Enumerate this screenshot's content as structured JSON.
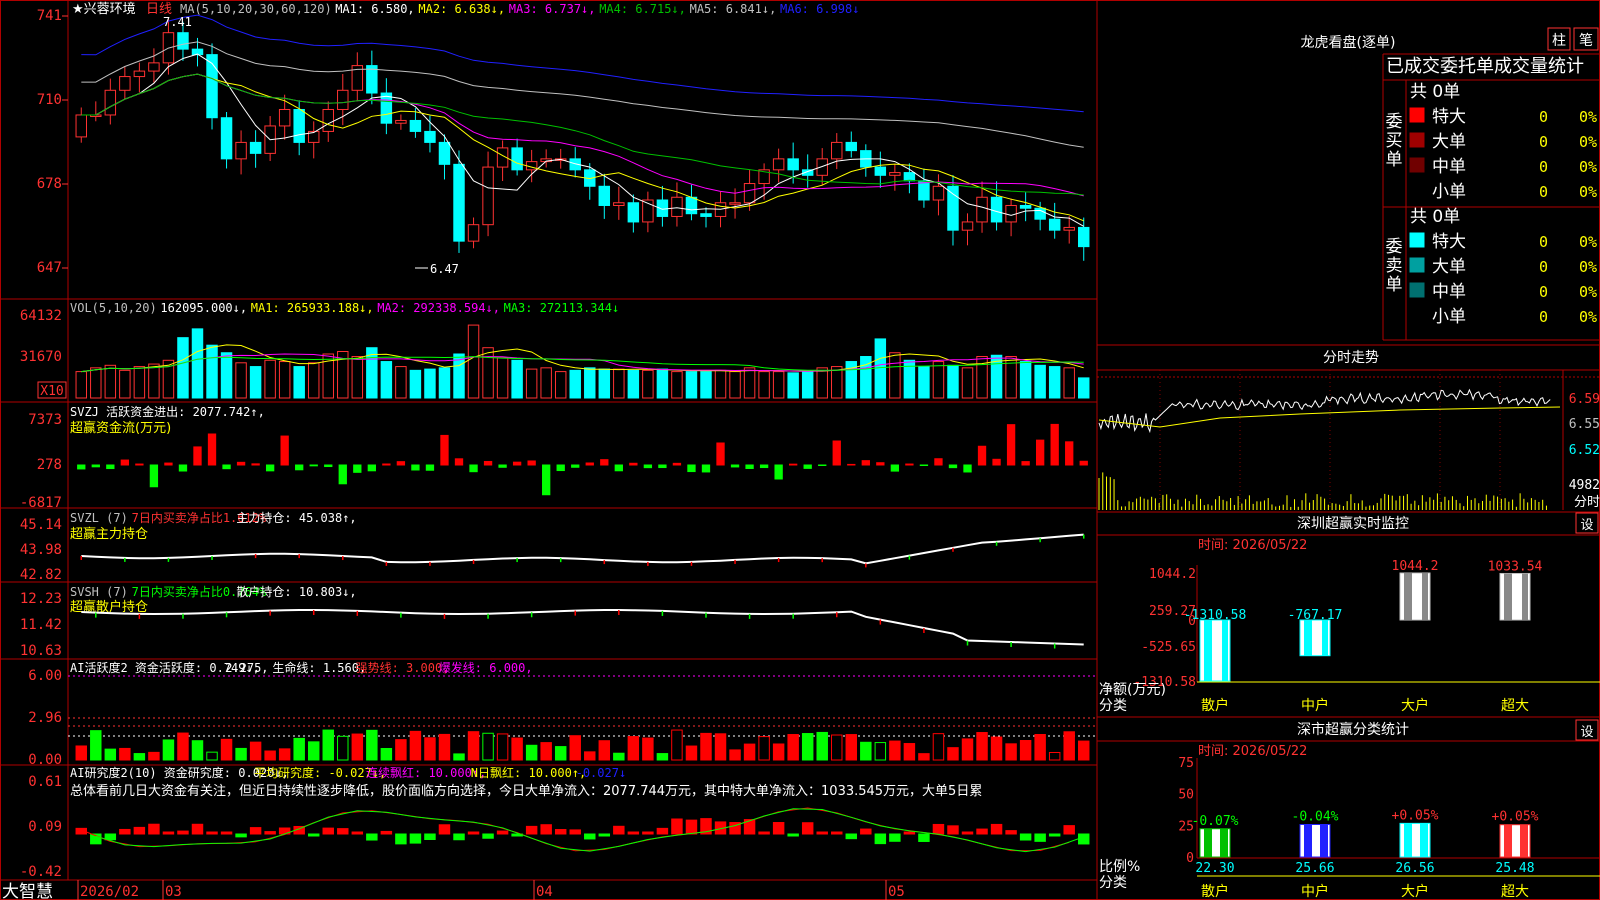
{
  "app": {
    "brand": "大智慧",
    "stock_name": "★兴蓉环境",
    "period": "日线",
    "pan_high_label": "7.41",
    "pan_low_label": "6.47"
  },
  "colors": {
    "up": "#ff3232",
    "down": "#00ffff",
    "grid": "#b00000",
    "ma1": "#ffffff",
    "ma2": "#ffff00",
    "ma3": "#ff00ff",
    "ma4": "#00c000",
    "ma5": "#c0c0c0",
    "ma6": "#2020ff"
  },
  "price_panel": {
    "header": [
      {
        "t": "MA(5,10,20,30,60,120)",
        "c": "#c0c0c0"
      },
      {
        "t": "MA1: 6.580,",
        "c": "#ffffff"
      },
      {
        "t": "MA2: 6.638↓,",
        "c": "#ffff00"
      },
      {
        "t": "MA3: 6.737↓,",
        "c": "#ff00ff"
      },
      {
        "t": "MA4: 6.715↓,",
        "c": "#00c000"
      },
      {
        "t": "MA5: 6.841↓,",
        "c": "#c0c0c0"
      },
      {
        "t": "MA6: 6.998↓",
        "c": "#2020ff"
      }
    ],
    "yticks": [
      "741",
      "710",
      "678",
      "647"
    ]
  },
  "vol_panel": {
    "header": [
      {
        "t": "VOL(5,10,20)",
        "c": "#c0c0c0"
      },
      {
        "t": "162095.000↓,",
        "c": "#ffffff"
      },
      {
        "t": "MA1: 265933.188↓,",
        "c": "#ffff00"
      },
      {
        "t": "MA2: 292338.594↓,",
        "c": "#ff00ff"
      },
      {
        "t": "MA3: 272113.344↓",
        "c": "#00ff00"
      }
    ],
    "yticks": [
      "64132",
      "31670"
    ],
    "unit": "X10"
  },
  "svzj_panel": {
    "header": [
      {
        "t": "SVZJ  活跃资金进出: 2077.742↑,",
        "c": "#ffffff"
      }
    ],
    "sub": "超赢资金流(万元)",
    "yticks": [
      "7373",
      "278",
      "-6817"
    ]
  },
  "svzl_panel": {
    "header": [
      {
        "t": "SVZL (7)",
        "c": "#c0c0c0"
      },
      {
        "t": "7日内买卖净占比1.612%",
        "c": "#ff3232"
      },
      {
        "t": "主力持仓: 45.038↑,",
        "c": "#ffffff"
      }
    ],
    "sub": "超赢主力持仓",
    "yticks": [
      "45.14",
      "43.98",
      "42.82"
    ]
  },
  "svsh_panel": {
    "header": [
      {
        "t": "SVSH (7)",
        "c": "#c0c0c0"
      },
      {
        "t": "7日内买卖净占比0.764%",
        "c": "#00ff00"
      },
      {
        "t": "散户持仓: 10.803↓,",
        "c": "#ffffff"
      }
    ],
    "sub": "超赢散户持仓",
    "yticks": [
      "12.23",
      "11.42",
      "10.63"
    ]
  },
  "ai1_panel": {
    "header": [
      {
        "t": "AI活跃度2 资金活跃度: 0.749↓,",
        "c": "#ffffff"
      },
      {
        "t": "2.275,",
        "c": "#ffffff"
      },
      {
        "t": "生命线: 1.560,",
        "c": "#ffffff"
      },
      {
        "t": "强势线: 3.000,",
        "c": "#ff3232"
      },
      {
        "t": "爆发线: 6.000,",
        "c": "#ff00ff"
      }
    ],
    "yticks": [
      "6.00",
      "2.96",
      "0.00"
    ]
  },
  "ai2_panel": {
    "header": [
      {
        "t": "AI研究度2(10) 资金研究度: 0.020↓,",
        "c": "#ffffff"
      },
      {
        "t": "平均研究度: -0.027↓,",
        "c": "#ffff00"
      },
      {
        "t": "连续飘红: 10.000↑,",
        "c": "#ff00ff"
      },
      {
        "t": "N日飘红: 10.000↑,",
        "c": "#ffff00"
      },
      {
        "t": "-0.027↓",
        "c": "#2020ff"
      }
    ],
    "summary": "总体看前几日大资金有关注，但近日持续性逐步降低，股价面临方向选择，今日大单净流入：2077.744万元，其中特大单净流入：1033.545万元，大单5日累",
    "yticks": [
      "0.61",
      "0.09",
      "-0.42"
    ]
  },
  "date_axis": [
    "2026/02",
    "03",
    "04",
    "05"
  ],
  "lhb": {
    "title": "龙虎看盘(逐单)",
    "btn_zhu": "柱",
    "btn_bi": "笔",
    "subtitle": "已成交委托单成交量统计",
    "buy_label": "委买单",
    "sell_label": "委卖单",
    "buy_total": "共 0单",
    "sell_total": "共 0单",
    "buy_rows": [
      {
        "name": "特大",
        "n": "0",
        "p": "0%",
        "c": "#ff0000"
      },
      {
        "name": "大单",
        "n": "0",
        "p": "0%",
        "c": "#a00000"
      },
      {
        "name": "中单",
        "n": "0",
        "p": "0%",
        "c": "#700000"
      },
      {
        "name": "小单",
        "n": "0",
        "p": "0%",
        "c": ""
      }
    ],
    "sell_rows": [
      {
        "name": "特大",
        "n": "0",
        "p": "0%",
        "c": "#00ffff"
      },
      {
        "name": "大单",
        "n": "0",
        "p": "0%",
        "c": "#00a0a0"
      },
      {
        "name": "中单",
        "n": "0",
        "p": "0%",
        "c": "#007070"
      },
      {
        "name": "小单",
        "n": "0",
        "p": "0%",
        "c": ""
      }
    ]
  },
  "intraday": {
    "title": "分时走势",
    "prices": [
      "6.59",
      "6.55",
      "6.52"
    ],
    "vol": "4982",
    "vol_unit": "分时"
  },
  "sz_monitor": {
    "title": "深圳超赢实时监控",
    "settings": "设",
    "date_label": "时间: 2026/05/22",
    "yticks": [
      "1044.2",
      "259.27",
      "0",
      "-525.65",
      "-1310.58"
    ],
    "ylabel": "净额(万元)",
    "xlabel": "分类",
    "categories": [
      "散户",
      "中户",
      "大户",
      "超大"
    ],
    "values": [
      "-1310.58",
      "-767.17",
      "1044.2",
      "1033.54"
    ]
  },
  "sz_class": {
    "title": "深市超赢分类统计",
    "settings": "设",
    "date_label": "时间: 2026/05/22",
    "yticks": [
      "75",
      "50",
      "25",
      "0"
    ],
    "ylabel": "比例%",
    "xlabel": "分类",
    "categories": [
      "散户",
      "中户",
      "大户",
      "超大"
    ],
    "values": [
      "22.30",
      "25.66",
      "26.56",
      "25.48"
    ],
    "changes": [
      "-0.07%",
      "-0.04%",
      "+0.05%",
      "+0.05%"
    ]
  },
  "chart_data": [
    {
      "type": "candlestick",
      "title": "★兴蓉环境 日线",
      "x": [
        "2026/02",
        "03",
        "04",
        "05"
      ],
      "open": [
        6.98,
        7.06,
        7.06,
        7.15,
        7.2,
        7.22,
        7.25,
        7.36,
        7.3,
        7.28,
        7.05,
        6.9,
        6.96,
        6.92,
        7.02,
        7.08,
        6.96,
        7.0,
        7.08,
        7.15,
        7.24,
        7.14,
        7.03,
        7.04,
        7.0,
        6.96,
        6.88,
        6.6,
        6.66,
        6.87,
        6.94,
        6.86,
        6.89,
        6.9,
        6.9,
        6.86,
        6.8,
        6.73,
        6.74,
        6.67,
        6.75,
        6.69,
        6.76,
        6.7,
        6.69,
        6.74,
        6.74,
        6.81,
        6.86,
        6.9,
        6.86,
        6.84,
        6.9,
        6.96,
        6.93,
        6.87,
        6.84,
        6.85,
        6.82,
        6.75,
        6.8,
        6.64,
        6.67,
        6.76,
        6.67,
        6.73,
        6.72,
        6.68,
        6.64,
        6.65
      ],
      "close": [
        7.06,
        7.06,
        7.15,
        7.2,
        7.22,
        7.25,
        7.36,
        7.3,
        7.28,
        7.05,
        6.9,
        6.96,
        6.92,
        7.02,
        7.08,
        6.96,
        7.0,
        7.08,
        7.15,
        7.24,
        7.14,
        7.03,
        7.04,
        7.0,
        6.96,
        6.88,
        6.6,
        6.66,
        6.87,
        6.94,
        6.86,
        6.89,
        6.9,
        6.9,
        6.86,
        6.8,
        6.73,
        6.74,
        6.67,
        6.75,
        6.69,
        6.76,
        6.7,
        6.69,
        6.74,
        6.74,
        6.81,
        6.86,
        6.9,
        6.86,
        6.84,
        6.9,
        6.96,
        6.93,
        6.87,
        6.84,
        6.85,
        6.82,
        6.75,
        6.8,
        6.64,
        6.67,
        6.76,
        6.67,
        6.73,
        6.72,
        6.68,
        6.64,
        6.65,
        6.58
      ],
      "ylim": [
        6.4,
        7.45
      ]
    },
    {
      "type": "bar",
      "title": "VOL(5,10,20)",
      "values": [
        21000,
        24000,
        26000,
        22000,
        25000,
        27000,
        30000,
        48000,
        55000,
        42000,
        36000,
        28000,
        25000,
        30000,
        29000,
        25000,
        28000,
        35000,
        37000,
        33000,
        40000,
        29000,
        25000,
        22000,
        23000,
        24000,
        35000,
        58000,
        40000,
        32000,
        30000,
        23000,
        24000,
        21000,
        22000,
        24000,
        23000,
        23000,
        22000,
        22000,
        23000,
        21000,
        21000,
        21000,
        22000,
        21000,
        24000,
        21000,
        21000,
        20000,
        21000,
        24000,
        25000,
        29000,
        33000,
        47000,
        36000,
        30000,
        25000,
        29000,
        26000,
        24000,
        33000,
        34000,
        33000,
        29000,
        26000,
        25000,
        24000,
        16000
      ],
      "ylim": [
        0,
        70000
      ]
    }
  ]
}
